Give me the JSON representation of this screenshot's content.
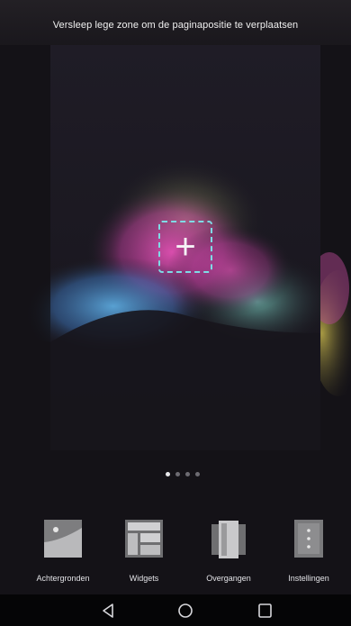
{
  "hint": "Versleep lege zone om de paginapositie te verplaatsen",
  "page_indicator": {
    "count": 4,
    "active": 1
  },
  "tray": [
    {
      "label": "Achtergronden",
      "icon": "wallpaper-icon"
    },
    {
      "label": "Widgets",
      "icon": "widgets-icon"
    },
    {
      "label": "Overgangen",
      "icon": "transitions-icon"
    },
    {
      "label": "Instellingen",
      "icon": "settings-icon"
    }
  ],
  "nav": [
    "back-icon",
    "home-icon",
    "recents-icon"
  ],
  "colors": {
    "accent": "#7fdbe6",
    "background": "#141217"
  }
}
